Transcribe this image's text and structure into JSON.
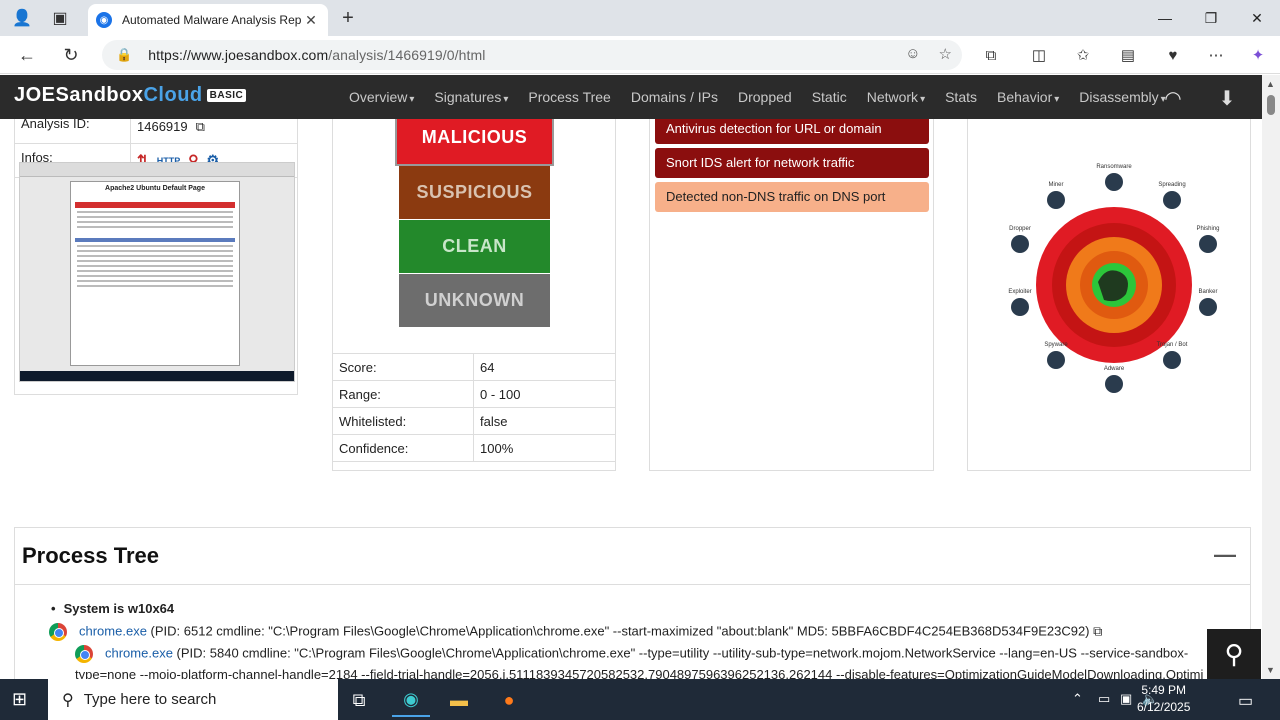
{
  "browser": {
    "tab_title": "Automated Malware Analysis Rep",
    "url_host": "https://www.joesandbox.com",
    "url_path": "/analysis/1466919/0/html"
  },
  "site": {
    "logo_main": "JOESandbox",
    "logo_cloud": "Cloud",
    "logo_badge": "BASIC",
    "menu": [
      {
        "label": "Overview",
        "dropdown": true
      },
      {
        "label": "Signatures",
        "dropdown": true
      },
      {
        "label": "Process Tree",
        "dropdown": false
      },
      {
        "label": "Domains / IPs",
        "dropdown": false
      },
      {
        "label": "Dropped",
        "dropdown": false
      },
      {
        "label": "Static",
        "dropdown": false
      },
      {
        "label": "Network",
        "dropdown": true
      },
      {
        "label": "Stats",
        "dropdown": false
      },
      {
        "label": "Behavior",
        "dropdown": true
      },
      {
        "label": "Disassembly",
        "dropdown": true
      }
    ]
  },
  "info": {
    "analysis_id_label": "Analysis ID:",
    "analysis_id_value": "1466919",
    "infos_label": "Infos:",
    "screenshot_title": "Apache2 Ubuntu Default Page"
  },
  "verdicts": {
    "malicious": "MALICIOUS",
    "suspicious": "SUSPICIOUS",
    "clean": "CLEAN",
    "unknown": "UNKNOWN"
  },
  "score": {
    "rows": [
      {
        "k": "Score:",
        "v": "64"
      },
      {
        "k": "Range:",
        "v": "0 - 100"
      },
      {
        "k": "Whitelisted:",
        "v": "false"
      },
      {
        "k": "Confidence:",
        "v": "100%"
      }
    ]
  },
  "signatures": [
    {
      "text": "Antivirus detection for URL or domain",
      "level": "red"
    },
    {
      "text": "Snort IDS alert for network traffic",
      "level": "red"
    },
    {
      "text": "Detected non-DNS traffic on DNS port",
      "level": "orange"
    }
  ],
  "radar_labels": [
    "Ransomware",
    "Miner",
    "Spreading",
    "Dropper",
    "Phishing",
    "Exploiter",
    "Banker",
    "Spyware",
    "Trojan / Bot",
    "Adware"
  ],
  "process_tree": {
    "title": "Process Tree",
    "system": "System is w10x64",
    "entries": [
      {
        "name": "chrome.exe",
        "details": " (PID: 6512 cmdline: \"C:\\Program Files\\Google\\Chrome\\Application\\chrome.exe\" --start-maximized \"about:blank\" MD5: 5BBFA6CBDF4C254EB368D534F9E23C92)"
      },
      {
        "name": "chrome.exe",
        "details": " (PID: 5840 cmdline: \"C:\\Program Files\\Google\\Chrome\\Application\\chrome.exe\" --type=utility --utility-sub-type=network.mojom.NetworkService --lang=en-US --service-sandbox-"
      },
      {
        "name": "",
        "details": "type=none --mojo-platform-channel-handle=2184 --field-trial-handle=2056,i,5111839345720582532,7904897596396252136,262144 --disable-features=OptimizationGuideModelDownloading,Optimi"
      }
    ]
  },
  "taskbar": {
    "search_placeholder": "Type here to search",
    "time": "5:49 PM",
    "date": "6/12/2025"
  },
  "colors": {
    "malicious": "#e01b24",
    "suspicious": "#8b3a10",
    "clean": "#23892b",
    "unknown": "#6d6d6d",
    "sig_red": "#8b0e0e",
    "sig_orange": "#f7b08a"
  }
}
